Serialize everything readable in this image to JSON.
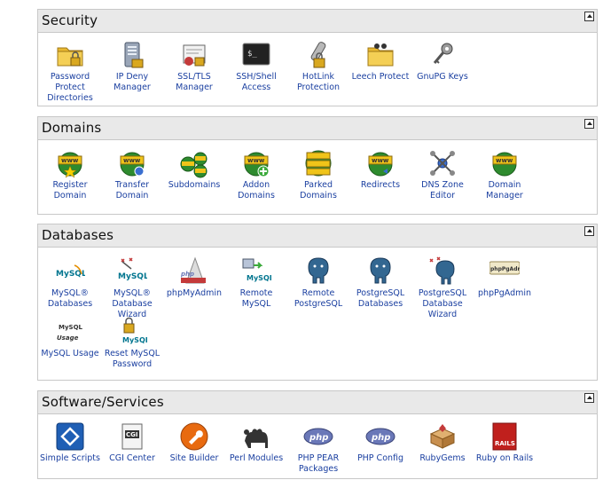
{
  "sections": [
    {
      "title": "Security",
      "items": [
        {
          "label": "Password Protect Directories",
          "icon": "locked-folder-icon"
        },
        {
          "label": "IP Deny Manager",
          "icon": "server-deny-icon"
        },
        {
          "label": "SSL/TLS Manager",
          "icon": "ssl-certificate-icon"
        },
        {
          "label": "SSH/Shell Access",
          "icon": "terminal-icon"
        },
        {
          "label": "HotLink Protection",
          "icon": "hotlink-lock-icon"
        },
        {
          "label": "Leech Protect",
          "icon": "leech-folder-icon"
        },
        {
          "label": "GnuPG Keys",
          "icon": "keys-icon"
        }
      ]
    },
    {
      "title": "Domains",
      "items": [
        {
          "label": "Register Domain",
          "icon": "globe-star-icon"
        },
        {
          "label": "Transfer Domain",
          "icon": "globe-transfer-icon"
        },
        {
          "label": "Subdomains",
          "icon": "globes-icon"
        },
        {
          "label": "Addon Domains",
          "icon": "globe-add-icon"
        },
        {
          "label": "Parked Domains",
          "icon": "globes-stacked-icon"
        },
        {
          "label": "Redirects",
          "icon": "globe-redirect-icon"
        },
        {
          "label": "DNS Zone Editor",
          "icon": "dns-network-icon"
        },
        {
          "label": "Domain Manager",
          "icon": "globe-icon"
        }
      ]
    },
    {
      "title": "Databases",
      "items": [
        {
          "label": "MySQL® Databases",
          "icon": "mysql-icon"
        },
        {
          "label": "MySQL® Database Wizard",
          "icon": "mysql-wizard-icon"
        },
        {
          "label": "phpMyAdmin",
          "icon": "phpmyadmin-icon"
        },
        {
          "label": "Remote MySQL",
          "icon": "mysql-remote-icon"
        },
        {
          "label": "Remote PostgreSQL",
          "icon": "postgresql-icon"
        },
        {
          "label": "PostgreSQL Databases",
          "icon": "postgresql-icon"
        },
        {
          "label": "PostgreSQL Database Wizard",
          "icon": "postgresql-wizard-icon"
        },
        {
          "label": "phpPgAdmin",
          "icon": "phppgadmin-icon"
        },
        {
          "label": "MySQL Usage",
          "icon": "mysql-usage-icon"
        },
        {
          "label": "Reset MySQL Password",
          "icon": "mysql-lock-icon"
        }
      ]
    },
    {
      "title": "Software/Services",
      "items": [
        {
          "label": "Simple Scripts",
          "icon": "simple-scripts-icon"
        },
        {
          "label": "CGI Center",
          "icon": "cgi-icon"
        },
        {
          "label": "Site Builder",
          "icon": "site-builder-icon"
        },
        {
          "label": "Perl Modules",
          "icon": "perl-camel-icon"
        },
        {
          "label": "PHP PEAR Packages",
          "icon": "php-icon"
        },
        {
          "label": "PHP Config",
          "icon": "php-icon"
        },
        {
          "label": "RubyGems",
          "icon": "gem-box-icon"
        },
        {
          "label": "Ruby on Rails",
          "icon": "rails-icon"
        }
      ]
    }
  ],
  "icon_text": {
    "www": "www",
    "mysql": "MySQL",
    "php": "php",
    "phppg": "phpPgAdmin",
    "cgi": "CGI",
    "rails": "RAILS",
    "terminal": "$_",
    "usage": "Usage"
  },
  "colors": {
    "accent_link": "#1a3fa0",
    "header_bg": "#e9e9e9",
    "globe_green": "#2e8b2e",
    "globe_yellow": "#f0c419",
    "folder_yellow": "#e8b830",
    "postgres_blue": "#336791",
    "mysql_blue": "#00758f",
    "php_purple": "#6a78b8",
    "rails_red": "#c0201d"
  }
}
